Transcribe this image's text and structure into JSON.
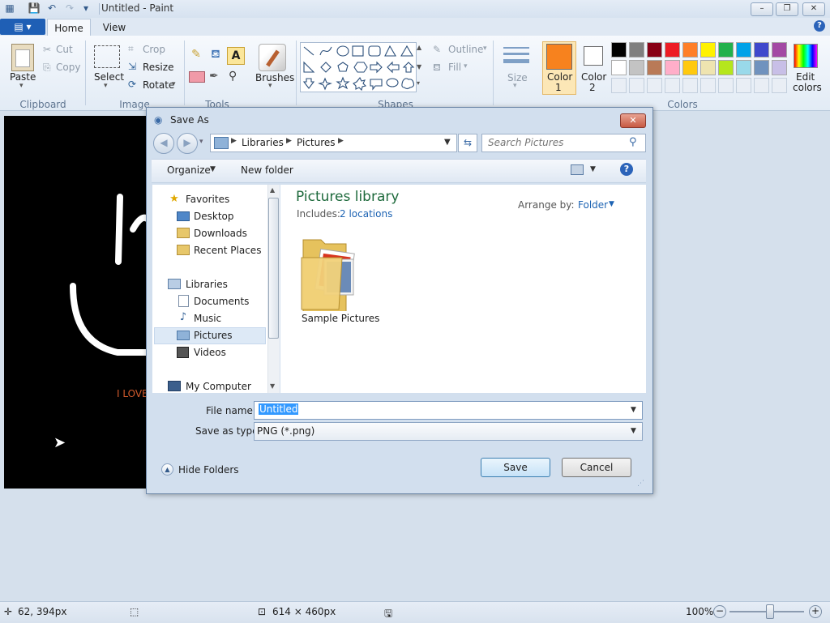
{
  "window": {
    "title": "Untitled - Paint",
    "minimize": "–",
    "maximize": "❐",
    "close": "✕"
  },
  "tabs": {
    "file": "▤ ▾",
    "home": "Home",
    "view": "View",
    "help": "?"
  },
  "ribbon": {
    "clipboard": {
      "group": "Clipboard",
      "paste": "Paste",
      "cut": "Cut",
      "copy": "Copy"
    },
    "image": {
      "group": "Image",
      "select": "Select",
      "crop": "Crop",
      "resize": "Resize",
      "rotate": "Rotate"
    },
    "tools": {
      "group": "Tools"
    },
    "brushes": {
      "label": "Brushes"
    },
    "shapes": {
      "group": "Shapes",
      "outline": "Outline",
      "fill": "Fill"
    },
    "size": {
      "label": "Size"
    },
    "color1": {
      "label": "Color",
      "num": "1",
      "value": "#f7821e"
    },
    "color2": {
      "label": "Color",
      "num": "2",
      "value": "#ffffff"
    },
    "colors": {
      "group": "Colors",
      "row1": [
        "#000000",
        "#7f7f7f",
        "#880015",
        "#ed1c24",
        "#ff7f27",
        "#fff200",
        "#22b14c",
        "#00a2e8",
        "#3f48cc",
        "#a349a4"
      ],
      "row2": [
        "#ffffff",
        "#c3c3c3",
        "#b97a57",
        "#ffaec9",
        "#ffc90e",
        "#efe4b0",
        "#b5e61d",
        "#99d9ea",
        "#7092be",
        "#c8bfe7"
      ]
    },
    "edit_colors": {
      "line1": "Edit",
      "line2": "colors"
    }
  },
  "canvas": {
    "text": "I LOVE"
  },
  "dialog": {
    "title": "Save As",
    "close": "✕",
    "breadcrumb": [
      "Libraries",
      "Pictures"
    ],
    "search_placeholder": "Search Pictures",
    "organize": "Organize",
    "new_folder": "New folder",
    "nav": {
      "favorites": "Favorites",
      "desktop": "Desktop",
      "downloads": "Downloads",
      "recent": "Recent Places",
      "libraries": "Libraries",
      "documents": "Documents",
      "music": "Music",
      "pictures": "Pictures",
      "videos": "Videos",
      "computer": "My Computer"
    },
    "library_title": "Pictures library",
    "includes_label": "Includes:",
    "includes_link": "2 locations",
    "arrange_label": "Arrange by:",
    "arrange_value": "Folder",
    "folder_name": "Sample Pictures",
    "file_name_label": "File name:",
    "file_name_value": "Untitled",
    "save_type_label": "Save as type:",
    "save_type_value": "PNG (*.png)",
    "hide_folders": "Hide Folders",
    "save": "Save",
    "cancel": "Cancel"
  },
  "status": {
    "cursor": "62, 394px",
    "size": "614 × 460px",
    "zoom": "100%",
    "minus": "−",
    "plus": "+"
  }
}
